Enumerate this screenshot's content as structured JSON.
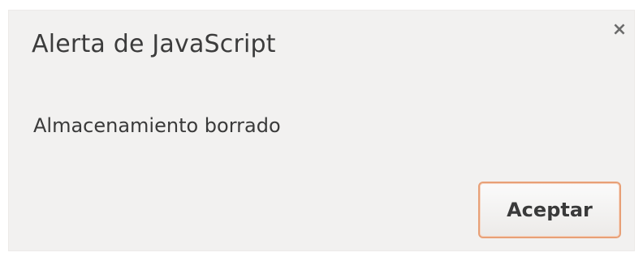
{
  "dialog": {
    "title": "Alerta de JavaScript",
    "close_glyph": "×",
    "close_icon": "close-icon",
    "message": "Almacenamiento borrado",
    "ok_label": "Aceptar",
    "accent_color": "#e8a077"
  }
}
